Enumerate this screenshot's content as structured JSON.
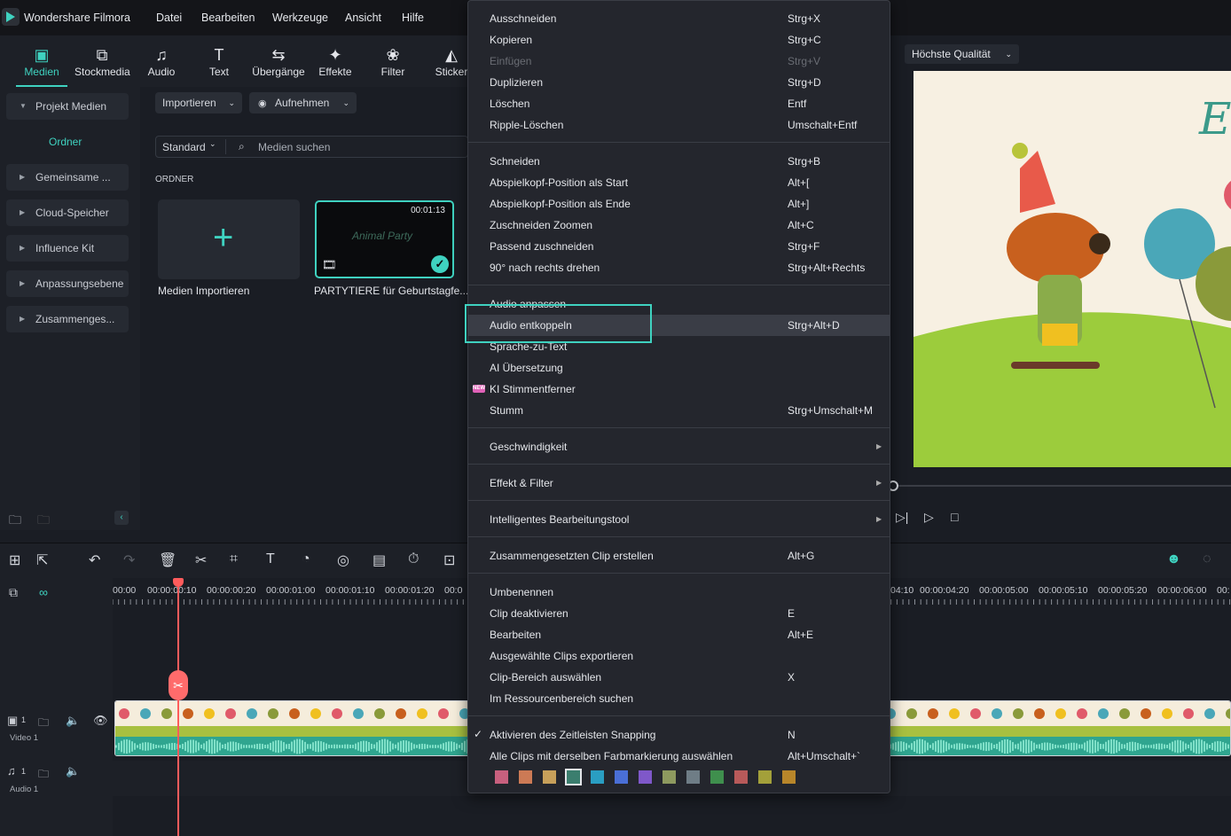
{
  "app": {
    "name": "Wondershare Filmora",
    "menus": [
      "Datei",
      "Bearbeiten",
      "Werkzeuge",
      "Ansicht",
      "Hilfe"
    ]
  },
  "toolbar": {
    "tabs": [
      {
        "label": "Medien",
        "icon": "media-icon",
        "active": true
      },
      {
        "label": "Stockmedia",
        "icon": "stockmedia-icon"
      },
      {
        "label": "Audio",
        "icon": "music-note-icon"
      },
      {
        "label": "Text",
        "icon": "text-icon"
      },
      {
        "label": "Übergänge",
        "icon": "transition-icon"
      },
      {
        "label": "Effekte",
        "icon": "effects-icon"
      },
      {
        "label": "Filter",
        "icon": "filter-icon"
      },
      {
        "label": "Sticker",
        "icon": "sticker-icon"
      }
    ]
  },
  "sidebar": {
    "project_media": "Projekt Medien",
    "ordner": "Ordner",
    "items": [
      "Gemeinsame ...",
      "Cloud-Speicher",
      "Influence Kit",
      "Anpassungsebene",
      "Zusammenges..."
    ]
  },
  "media": {
    "import_label": "Importieren",
    "record_label": "Aufnehmen",
    "sort_label": "Standard",
    "search_placeholder": "Medien suchen",
    "folder_heading": "ORDNER",
    "import_tile_label": "Medien Importieren",
    "clip_duration": "00:01:13",
    "clip_title_overlay": "Animal Party",
    "clip_label": "PARTYTIERE für Geburtstagfe..."
  },
  "preview": {
    "quality": "Höchste Qualität",
    "title_partial": "E("
  },
  "timeline": {
    "ruler_labels": [
      "00:00",
      "00:00:00:10",
      "00:00:00:20",
      "00:00:01:00",
      "00:00:01:10",
      "00:00:01:20",
      "00:0",
      "04:10",
      "00:00:04:20",
      "00:00:05:00",
      "00:00:05:10",
      "00:00:05:20",
      "00:00:06:00",
      "00:"
    ],
    "video_track": "Video 1",
    "audio_track": "Audio 1",
    "track_number": "1"
  },
  "context_menu": {
    "groups": [
      [
        {
          "label": "Ausschneiden",
          "shortcut": "Strg+X"
        },
        {
          "label": "Kopieren",
          "shortcut": "Strg+C"
        },
        {
          "label": "Einfügen",
          "shortcut": "Strg+V",
          "disabled": true
        },
        {
          "label": "Duplizieren",
          "shortcut": "Strg+D"
        },
        {
          "label": "Löschen",
          "shortcut": "Entf"
        },
        {
          "label": "Ripple-Löschen",
          "shortcut": "Umschalt+Entf"
        }
      ],
      [
        {
          "label": "Schneiden",
          "shortcut": "Strg+B"
        },
        {
          "label": "Abspielkopf-Position als Start",
          "shortcut": "Alt+["
        },
        {
          "label": "Abspielkopf-Position als Ende",
          "shortcut": "Alt+]"
        },
        {
          "label": "Zuschneiden  Zoomen",
          "shortcut": "Alt+C"
        },
        {
          "label": "Passend zuschneiden",
          "shortcut": "Strg+F"
        },
        {
          "label": "90° nach rechts drehen",
          "shortcut": "Strg+Alt+Rechts"
        }
      ],
      [
        {
          "label": "Audio anpassen",
          "shortcut": ""
        },
        {
          "label": "Audio entkoppeln",
          "shortcut": "Strg+Alt+D",
          "highlighted": true
        },
        {
          "label": "Sprache-zu-Text",
          "shortcut": ""
        },
        {
          "label": "AI Übersetzung",
          "shortcut": ""
        },
        {
          "label": "KI Stimmentferner",
          "shortcut": "",
          "badge": "NEW"
        },
        {
          "label": "Stumm",
          "shortcut": "Strg+Umschalt+M"
        }
      ],
      [
        {
          "label": "Geschwindigkeit",
          "submenu": true
        }
      ],
      [
        {
          "label": "Effekt & Filter",
          "submenu": true
        }
      ],
      [
        {
          "label": "Intelligentes Bearbeitungstool",
          "submenu": true
        }
      ],
      [
        {
          "label": "Zusammengesetzten Clip erstellen",
          "shortcut": "Alt+G"
        }
      ],
      [
        {
          "label": "Umbenennen",
          "shortcut": ""
        },
        {
          "label": "Clip deaktivieren",
          "shortcut": "E"
        },
        {
          "label": "Bearbeiten",
          "shortcut": "Alt+E"
        },
        {
          "label": "Ausgewählte Clips exportieren",
          "shortcut": ""
        },
        {
          "label": "Clip-Bereich auswählen",
          "shortcut": "X"
        },
        {
          "label": "Im Ressourcenbereich suchen",
          "shortcut": ""
        }
      ],
      [
        {
          "label": "Aktivieren des Zeitleisten Snapping",
          "shortcut": "N",
          "checked": true
        },
        {
          "label": "Alle Clips mit derselben Farbmarkierung auswählen",
          "shortcut": "Alt+Umschalt+`"
        }
      ]
    ],
    "color_swatches": [
      "#c8607e",
      "#cc7a55",
      "#c7a05a",
      "#3b7e6e",
      "#2a9ec2",
      "#4a6fd6",
      "#7f58c9",
      "#8e9a5f",
      "#6f7d86",
      "#3f8f4d",
      "#b85a5a",
      "#a3a03a",
      "#b8862a"
    ],
    "selected_swatch": 3
  }
}
